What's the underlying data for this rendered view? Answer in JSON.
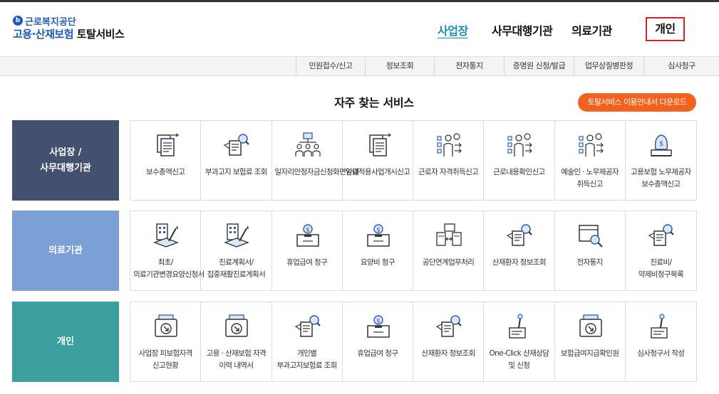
{
  "header": {
    "logo_mark": "b",
    "agency": "근로복지공단",
    "title_part1": "고용·산재보험",
    "title_part2": " 토탈서비스"
  },
  "gnb": [
    "사업장",
    "사무대행기관",
    "의료기관",
    "개인"
  ],
  "subnav": [
    "민원접수/신고",
    "정보조회",
    "전자통지",
    "증명원 신청/발급",
    "업무상질병판정",
    "심사청구"
  ],
  "section": {
    "title": "자주 찾는 서비스",
    "download_label": "토탈서비스 이용안내서 다운로드"
  },
  "categories": [
    {
      "label": "사업장 /\n사무대행기관",
      "items": [
        {
          "icon": "document-send-icon",
          "label": "보수총액신고"
        },
        {
          "icon": "bill-search-icon",
          "label": "부과고지 보험료 조회"
        },
        {
          "icon": "org-chart-icon",
          "label": "일자리안정자금신청화면안내"
        },
        {
          "icon": "document-send-icon",
          "label": "일괄적용사업개시신고"
        },
        {
          "icon": "worker-list-icon",
          "label": "근로자 자격취득신고"
        },
        {
          "icon": "worker-list-icon",
          "label": "근로내용확인신고"
        },
        {
          "icon": "worker-list-icon",
          "label": "예술인 · 노무제공자 취득신고"
        },
        {
          "icon": "money-bag-icon",
          "label": "고용보험 노무제공자 보수총액신고"
        }
      ]
    },
    {
      "label": "의료기관",
      "items": [
        {
          "icon": "building-pen-icon",
          "label": "최초/의료기관변경요양신청서"
        },
        {
          "icon": "building-pen-icon",
          "label": "진료계획서/집중재활진료계획서"
        },
        {
          "icon": "coin-box-icon",
          "label": "휴업급여 청구"
        },
        {
          "icon": "coin-box-icon",
          "label": "요양비 청구"
        },
        {
          "icon": "document-exchange-icon",
          "label": "공단연계업무처리"
        },
        {
          "icon": "bill-search-icon",
          "label": "산재환자 정보조회"
        },
        {
          "icon": "box-search-icon",
          "label": "전자통지"
        },
        {
          "icon": "bill-search-icon",
          "label": "진료비/약제비청구목록"
        }
      ]
    },
    {
      "label": "개인",
      "items": [
        {
          "icon": "download-box-icon",
          "label": "사업장 피보험자격 신고현황"
        },
        {
          "icon": "download-box-icon",
          "label": "고용 · 산재보험 자격 이력 내역서"
        },
        {
          "icon": "bill-search-icon",
          "label": "개인별 부과고지보험료 조회"
        },
        {
          "icon": "coin-box-icon",
          "label": "휴업급여 청구"
        },
        {
          "icon": "bill-search-icon",
          "label": "산재환자 정보조회"
        },
        {
          "icon": "pen-document-icon",
          "label": "One-Click 산재상담 및 신청"
        },
        {
          "icon": "download-box-icon",
          "label": "보험급여지급확인원"
        },
        {
          "icon": "pen-document-icon",
          "label": "심사청구서 작성"
        }
      ]
    }
  ],
  "colors": {
    "brand_blue": "#1e5ab4",
    "active_menu": "#1a8fb8",
    "highlight_border": "#d9221f",
    "download_button": "#f2621c",
    "category_business": "#435070",
    "category_medical": "#7c9fd6",
    "category_personal": "#3a9f9d"
  }
}
